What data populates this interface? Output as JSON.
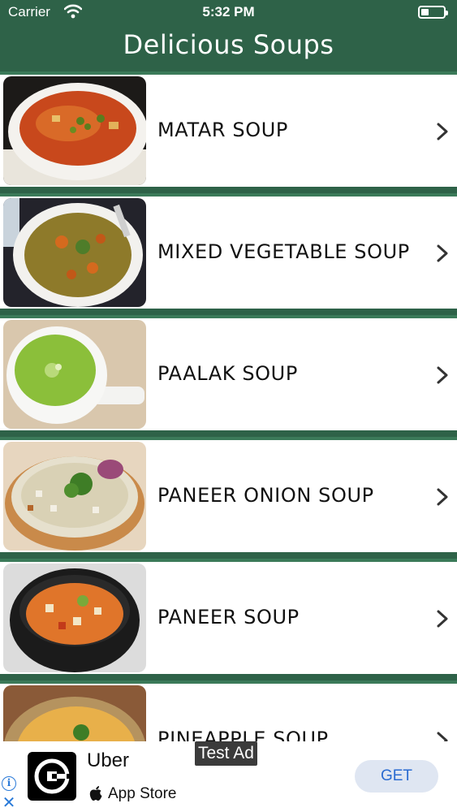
{
  "status_bar": {
    "carrier": "Carrier",
    "time": "5:32 PM",
    "battery_level": 0.35
  },
  "nav": {
    "title": "Delicious Soups",
    "color": "#2e6248"
  },
  "soups": [
    {
      "label": "MATAR SOUP",
      "icon": "chevron-right-icon"
    },
    {
      "label": "MIXED VEGETABLE SOUP",
      "icon": "chevron-right-icon"
    },
    {
      "label": "PAALAK SOUP",
      "icon": "chevron-right-icon"
    },
    {
      "label": "PANEER ONION SOUP",
      "icon": "chevron-right-icon"
    },
    {
      "label": "PANEER SOUP",
      "icon": "chevron-right-icon"
    },
    {
      "label": "PINEAPPLE SOUP",
      "icon": "chevron-right-icon"
    }
  ],
  "ad": {
    "badge": "Test Ad",
    "app_name": "Uber",
    "store": "App Store",
    "cta": "GET",
    "info_symbol": "i",
    "close_symbol": "✕"
  }
}
